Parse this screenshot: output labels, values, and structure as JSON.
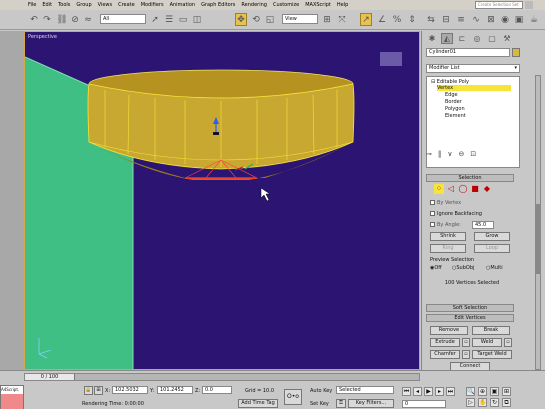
{
  "menu": [
    "File",
    "Edit",
    "Tools",
    "Group",
    "Views",
    "Create",
    "Modifiers",
    "Animation",
    "Graph Editors",
    "Rendering",
    "Customize",
    "MAXScript",
    "Help"
  ],
  "search_placeholder": "Create Selection Set",
  "toolbar": {
    "filter_value": "All",
    "refcoord_value": "View",
    "icons": [
      "undo-icon",
      "redo-icon",
      "link-icon",
      "unlink-icon",
      "bind-icon",
      "select-icon",
      "select-by-name-icon",
      "rect-region-icon",
      "window-crossing-icon",
      "move-icon",
      "rotate-icon",
      "scale-icon",
      "pivot-icon",
      "select-manipulate-icon",
      "snap-icon",
      "angle-snap-icon",
      "percent-snap-icon",
      "spinner-snap-icon",
      "mirror-icon",
      "align-icon",
      "layer-icon",
      "curve-editor-icon",
      "schematic-icon",
      "material-icon",
      "render-icon",
      "quick-render-icon"
    ]
  },
  "viewport": {
    "label": "Perspective"
  },
  "panel": {
    "object_name": "Cylinder01",
    "modifier_list": "Modifier List",
    "stack": {
      "root": "Editable Poly",
      "subobjects": [
        "Vertex",
        "Edge",
        "Border",
        "Polygon",
        "Element"
      ],
      "selected_index": 0
    },
    "selection_rollout": "Selection",
    "by_vertex": "By Vertex",
    "ignore_backfacing": "Ignore Backfacing",
    "by_angle": "By Angle:",
    "by_angle_value": "45.0",
    "shrink": "Shrink",
    "grow": "Grow",
    "ring": "Ring",
    "loop": "Loop",
    "preview_selection": "Preview Selection",
    "preview_options": [
      "Off",
      "SubObj",
      "Multi"
    ],
    "status": "100 Vertices Selected",
    "soft_selection": "Soft Selection",
    "edit_vertices": "Edit Vertices",
    "remove": "Remove",
    "break": "Break",
    "extrude": "Extrude",
    "weld": "Weld",
    "chamfer": "Chamfer",
    "target_weld": "Target Weld",
    "connect": "Connect"
  },
  "timeline": {
    "frame_display": "0 / 100"
  },
  "status": {
    "maxscript": "A4Script.",
    "x_label": "X:",
    "x_value": "102.5032",
    "y_label": "Y:",
    "y_value": "101.2452",
    "z_label": "Z:",
    "z_value": "0.0",
    "grid": "Grid = 10.0",
    "render_time": "Rendering Time: 0:00:00",
    "add_time_tag": "Add Time Tag",
    "auto_key": "Auto Key",
    "set_key": "Set Key",
    "selected": "Selected",
    "key_filters": "Key Filters...",
    "frame_value": "0"
  },
  "colors": {
    "viewport_bg": "#2b1472",
    "cylinder": "#c9a831",
    "box": "#3fbf84",
    "highlight": "#f6e43a",
    "active_tool": "#e7c34d",
    "maxscript_bg": "#f08a8a"
  }
}
